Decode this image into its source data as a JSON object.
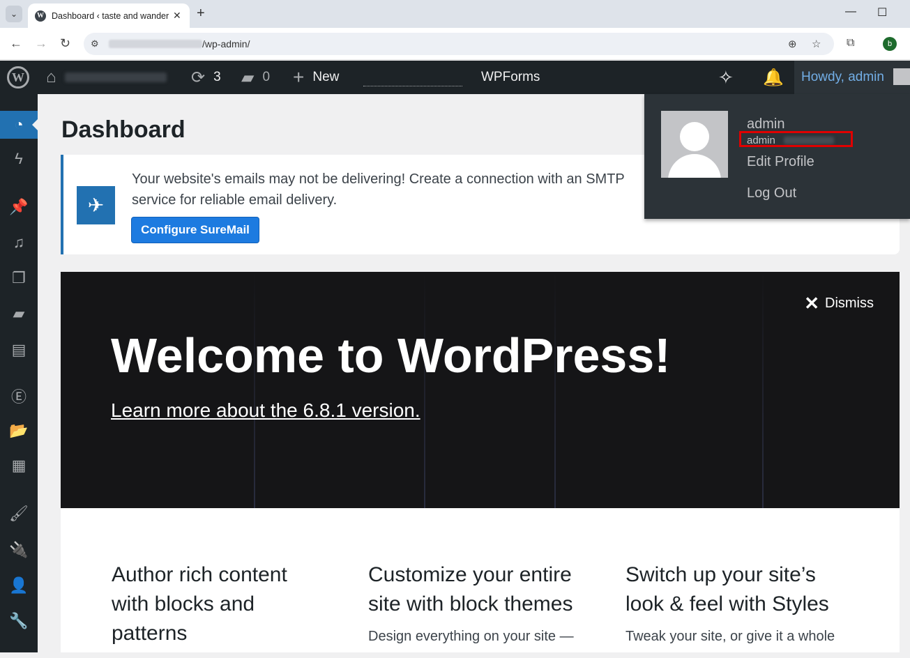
{
  "browser": {
    "tab_title": "Dashboard ‹ taste and wander",
    "url_path": "/wp-admin/",
    "profile_initial": "b"
  },
  "adminbar": {
    "updates_count": "3",
    "comments_count": "0",
    "new_label": "New",
    "wpforms_label": "WPForms",
    "howdy": "Howdy, admin"
  },
  "page": {
    "title": "Dashboard"
  },
  "notice": {
    "text": "Your website's emails may not be delivering! Create a connection with an SMTP service for reliable email delivery.",
    "button": "Configure SureMail"
  },
  "welcome": {
    "dismiss": "Dismiss",
    "title": "Welcome to WordPress!",
    "link": "Learn more about the 6.8.1 version."
  },
  "features": [
    {
      "title": "Author rich content with blocks and patterns",
      "desc": ""
    },
    {
      "title": "Customize your entire site with block themes",
      "desc": "Design everything on your site —"
    },
    {
      "title": "Switch up your site’s look & feel with Styles",
      "desc": "Tweak your site, or give it a whole"
    }
  ],
  "user_menu": {
    "display_name": "admin",
    "username": "admin",
    "edit_profile": "Edit Profile",
    "log_out": "Log Out"
  },
  "colors": {
    "admin_bar": "#1d2327",
    "accent": "#2271b1",
    "link": "#72aee6",
    "highlight_box": "#e00000"
  }
}
